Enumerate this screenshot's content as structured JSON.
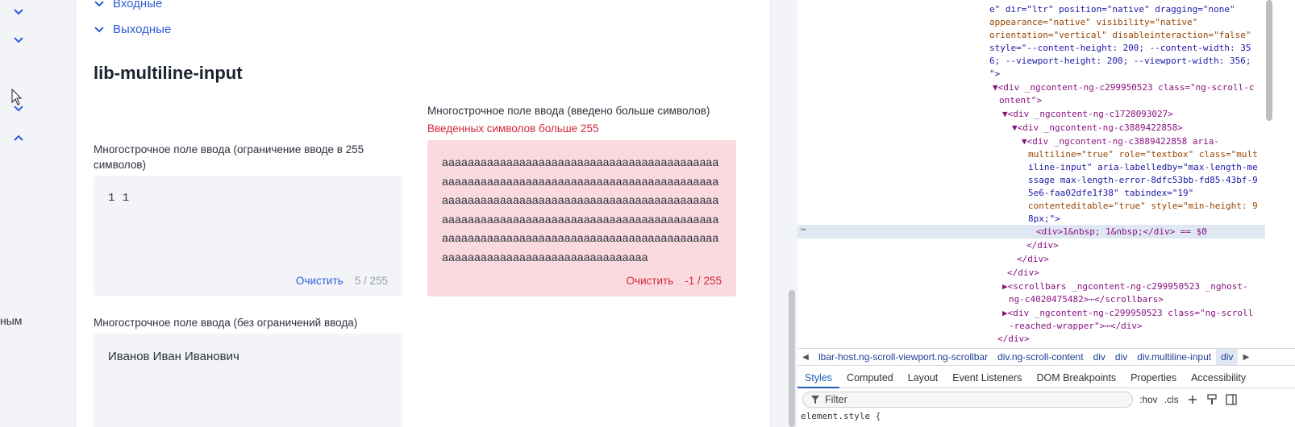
{
  "sidebar": {
    "chevrons": [
      "chevron-down-icon",
      "chevron-down-icon",
      "chevron-down-icon",
      "chevron-up-icon"
    ],
    "cut_text": "ным"
  },
  "accordion": {
    "inputs_label": "Входные",
    "outputs_label": "Выходные"
  },
  "section": {
    "title": "lib-multiline-input"
  },
  "fields": {
    "limited": {
      "label": "Многострочное поле ввода (ограничение вводе в 255 символов)",
      "value": "1  1",
      "clear_label": "Очистить",
      "counter": "5 / 255"
    },
    "over": {
      "label": "Многострочное поле ввода (введено больше символов)",
      "error": "Введенных символов больше 255",
      "value": "aaaaaaaaaaaaaaaaaaaaaaaaaaaaaaaaaaaaaaaaaaaaaaaaaaaaaaaaaaaaaaaaaaaaaaaaaaaaaaaaaaaaaaaaaaaaaaaaaaaaaaaaaaaaaaaaaaaaaaaaaaaaaaaaaaaaaaaaaaaaaaaaaaaaaaaaaaaaaaaaaaaaaaaaaaaaaaaaaaaaaaaaaaaaaaaaaaaaaaaaaaaaaaaaaaaaaaaaaaaaaaaaaaaaaaaaaaaaaaaaaaaaaaa",
      "clear_label": "Очистить",
      "counter": "-1 / 255"
    },
    "unlimited": {
      "label": "Многострочное поле ввода (без ограничений ввода)",
      "value": "Иванов Иван Иванович"
    }
  },
  "devtools": {
    "dom_lines": [
      "e\" dir=\"ltr\" position=\"native\" dragging=\"none\"",
      "appearance=\"native\" visibility=\"native\"",
      "orientation=\"vertical\" disableinteraction=\"false\"",
      "style=\"--content-height: 200; --content-width: 35",
      "6; --viewport-height: 200; --viewport-width: 356;",
      "\">",
      "▼<div _ngcontent-ng-c299950523 class=\"ng-scroll-c",
      "ontent\">",
      "▼<div _ngcontent-ng-c1728093027>",
      "▼<div _ngcontent-ng-c3889422858>",
      "▼<div _ngcontent-ng-c3889422858 aria-",
      "multiline=\"true\" role=\"textbox\" class=\"mult",
      "iline-input\" aria-labelledby=\"max-length-me",
      "ssage max-length-error-8dfc53bb-fd85-43bf-9",
      "5e6-faa02dfe1f38\" tabindex=\"19\"",
      "contenteditable=\"true\" style=\"min-height: 9",
      "8px;\">",
      "<div>1&nbsp; 1&nbsp;</div> == $0",
      "</div>",
      "</div>",
      "</div>",
      "▶<scrollbars _ngcontent-ng-c299950523 _nghost-",
      "ng-c4020475482>⋯</scrollbars>",
      "▶<div _ngcontent-ng-c299950523 class=\"ng-scroll",
      "-reached-wrapper\">⋯</div>",
      "</div>"
    ],
    "crumbs": [
      "lbar-host.ng-scroll-viewport.ng-scrollbar",
      "div.ng-scroll-content",
      "div",
      "div",
      "div.multiline-input",
      "div"
    ],
    "tabs": [
      "Styles",
      "Computed",
      "Layout",
      "Event Listeners",
      "DOM Breakpoints",
      "Properties",
      "Accessibility"
    ],
    "filter_placeholder": "Filter",
    "hov": ":hov",
    "cls": ".cls",
    "element_style": "element.style {"
  }
}
